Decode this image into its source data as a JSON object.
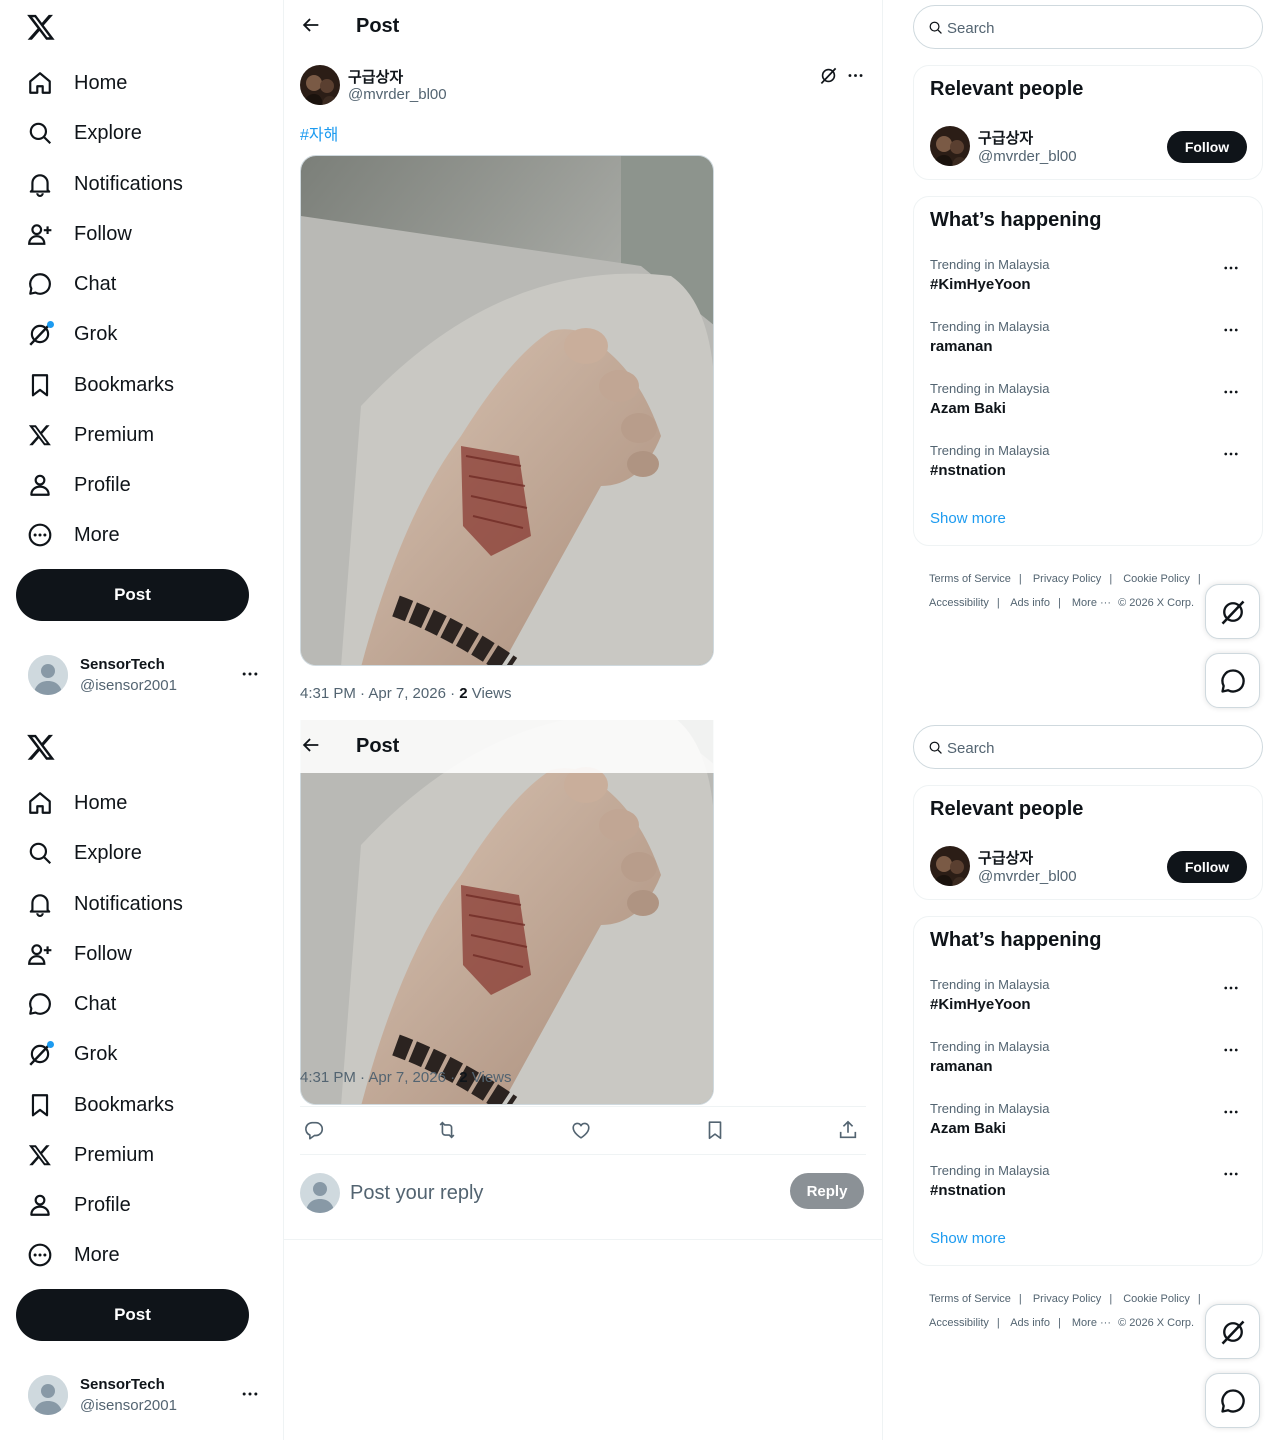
{
  "nav": {
    "items": [
      {
        "label": "Home",
        "icon": "home-icon"
      },
      {
        "label": "Explore",
        "icon": "search-icon"
      },
      {
        "label": "Notifications",
        "icon": "bell-icon"
      },
      {
        "label": "Follow",
        "icon": "person-add-icon"
      },
      {
        "label": "Chat",
        "icon": "chat-icon"
      },
      {
        "label": "Grok",
        "icon": "grok-icon"
      },
      {
        "label": "Bookmarks",
        "icon": "bookmark-icon"
      },
      {
        "label": "Premium",
        "icon": "x-logo-icon"
      },
      {
        "label": "Profile",
        "icon": "person-icon"
      },
      {
        "label": "More",
        "icon": "more-circle-icon"
      }
    ],
    "post_label": "Post"
  },
  "account": {
    "name": "SensorTech",
    "handle": "@isensor2001"
  },
  "main": {
    "title": "Post",
    "author": {
      "name": "구급상자",
      "handle": "@mvrder_bl00"
    },
    "hashtag": "#자해",
    "time": "4:31 PM · Apr 7, 2026 · ",
    "views_count": "2",
    "views_label": " Views",
    "reply_placeholder": "Post your reply",
    "reply_label": "Reply"
  },
  "search": {
    "placeholder": "Search"
  },
  "relevant": {
    "title": "Relevant people",
    "name": "구급상자",
    "handle": "@mvrder_bl00",
    "follow_label": "Follow"
  },
  "happening": {
    "title": "What’s happening",
    "trends": [
      {
        "context": "Trending in Malaysia",
        "name": "#KimHyeYoon"
      },
      {
        "context": "Trending in Malaysia",
        "name": "ramanan"
      },
      {
        "context": "Trending in Malaysia",
        "name": "Azam Baki"
      },
      {
        "context": "Trending in Malaysia",
        "name": "#nstnation"
      }
    ],
    "show_more": "Show more"
  },
  "footer": {
    "links": [
      "Terms of Service",
      "Privacy Policy",
      "Cookie Policy",
      "Accessibility",
      "Ads info",
      "More ···"
    ],
    "copyright": "© 2026 X Corp."
  },
  "colors": {
    "accent": "#1d9bf0",
    "text": "#0f1419",
    "muted": "#536471",
    "border": "#eff3f4"
  }
}
